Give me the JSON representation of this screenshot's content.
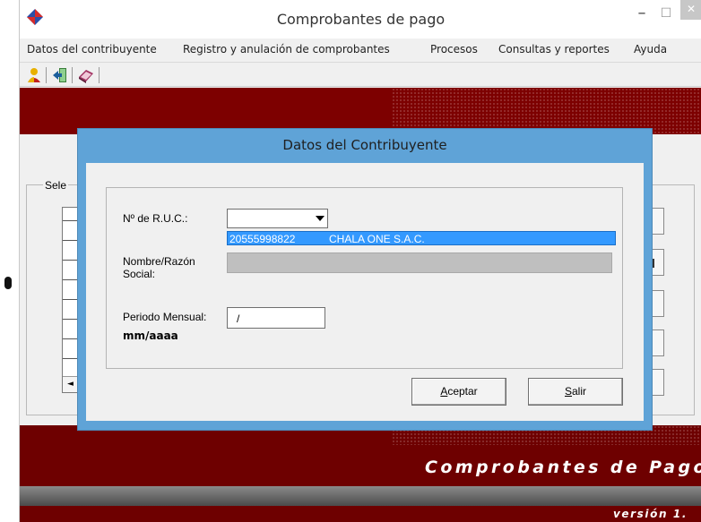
{
  "window": {
    "title": "Comprobantes de pago",
    "minimize": "–",
    "maximize": "☐",
    "close": "✕"
  },
  "menu": [
    "Datos del contribuyente",
    "Registro y anulación de comprobantes",
    "Procesos",
    "Consultas y reportes",
    "Ayuda"
  ],
  "toolbar": {
    "buttons": [
      "user-icon",
      "exit-icon",
      "book-icon"
    ]
  },
  "background": {
    "group_label": "Sele",
    "brand_title": "Comprobantes de Pago",
    "version": "versión 1.",
    "scroll_left": "◄"
  },
  "dialog": {
    "title": "Datos del Contribuyente",
    "ruc_label": "Nº de R.U.C.:",
    "ruc_value": "",
    "ruc_option_ruc": "20555998822",
    "ruc_option_name": "CHALA ONE S.A.C.",
    "name_label_line1": "Nombre/Razón",
    "name_label_line2": "Social:",
    "name_value": "",
    "period_label": "Periodo Mensual:",
    "period_value": "/",
    "period_format": "mm/aaaa",
    "accept_mnemonic": "A",
    "accept_rest": "ceptar",
    "exit_mnemonic": "S",
    "exit_rest": "alir"
  },
  "colors": {
    "banner": "#7d0000",
    "dialog_frame": "#5fa3d7",
    "selection": "#3399ff"
  }
}
